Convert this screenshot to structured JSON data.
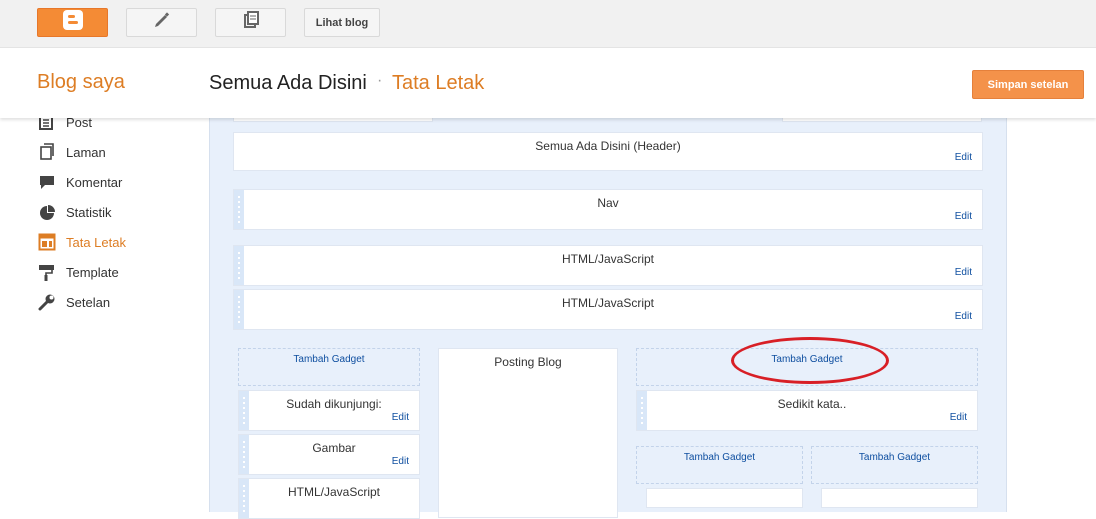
{
  "toolbar": {
    "view_blog_label": "Lihat blog"
  },
  "header": {
    "brand": "Blog saya",
    "blog_name": "Semua Ada Disini",
    "separator": "·",
    "page_title": "Tata Letak",
    "save_label": "Simpan setelan"
  },
  "sidebar": {
    "items": [
      {
        "label": "Post",
        "icon": "posts-icon"
      },
      {
        "label": "Laman",
        "icon": "pages-icon"
      },
      {
        "label": "Komentar",
        "icon": "comments-icon"
      },
      {
        "label": "Statistik",
        "icon": "stats-icon"
      },
      {
        "label": "Tata Letak",
        "icon": "layout-icon",
        "active": true
      },
      {
        "label": "Template",
        "icon": "template-icon"
      },
      {
        "label": "Setelan",
        "icon": "settings-icon"
      }
    ]
  },
  "layout": {
    "header_widget": "Semua Ada Disini (Header)",
    "nav_widget": "Nav",
    "html1": "HTML/JavaScript",
    "html2": "HTML/JavaScript",
    "edit": "Edit",
    "add_gadget": "Tambah Gadget",
    "left_col": {
      "w1": "Sudah dikunjungi:",
      "w2": "Gambar",
      "w3": "HTML/JavaScript"
    },
    "main_col": "Posting Blog",
    "right_col": {
      "w1": "Sedikit kata.."
    }
  },
  "colors": {
    "accent": "#dd7d24",
    "link": "#0f4fa0",
    "annotation": "#d81f26"
  }
}
